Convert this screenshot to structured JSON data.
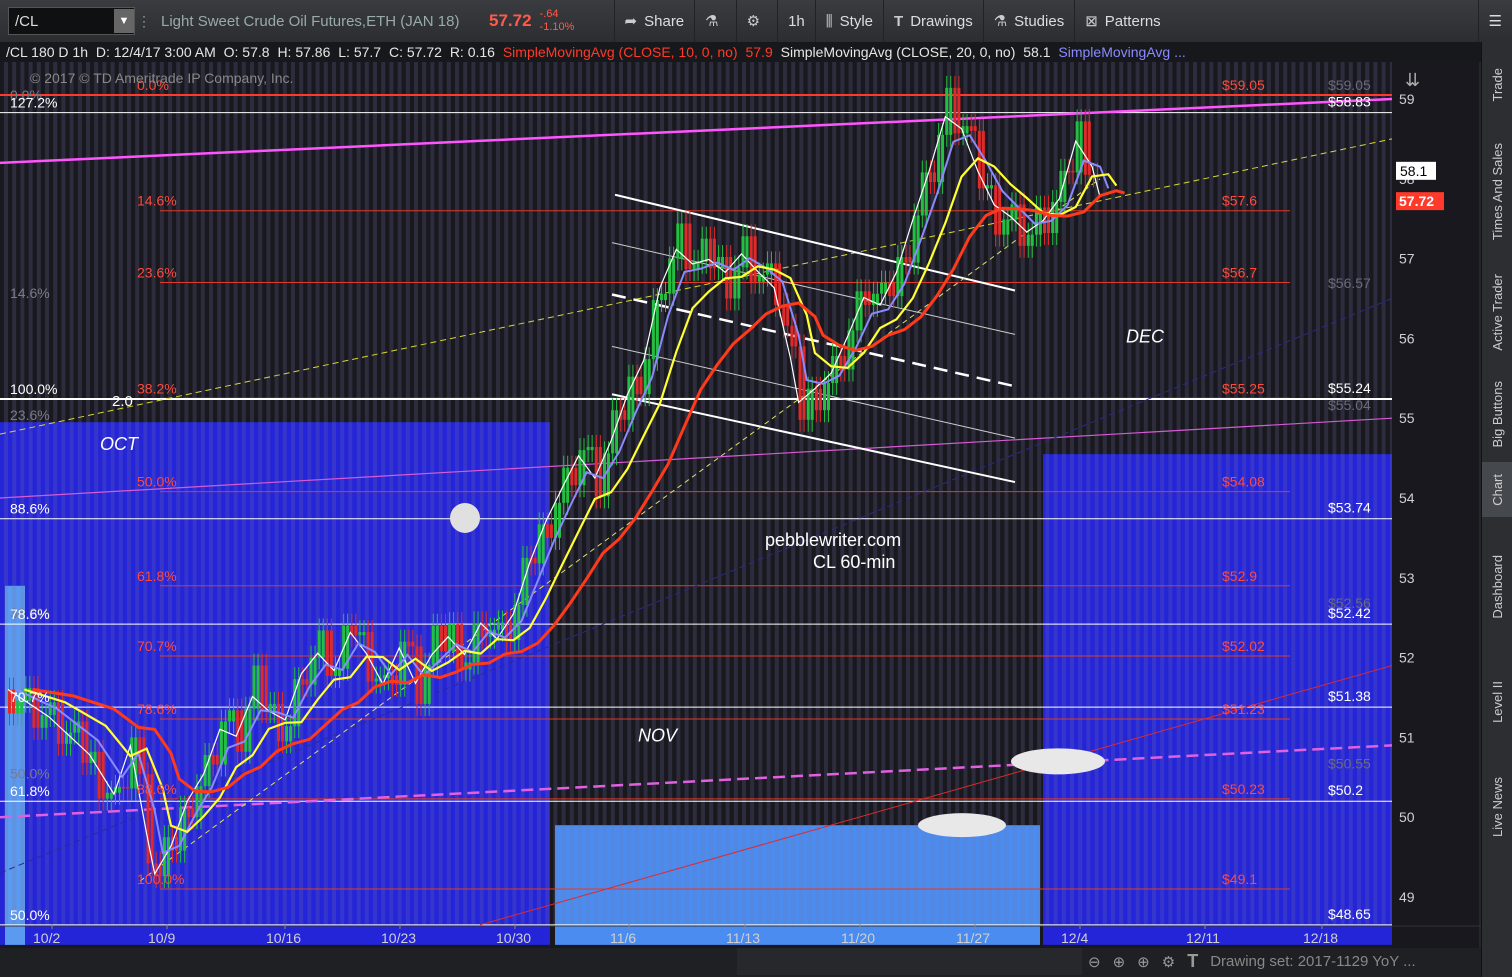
{
  "toolbar": {
    "symbol": "/CL",
    "description": "Light Sweet Crude Oil Futures,ETH (JAN 18)",
    "last_price": "57.72",
    "change": "-.64",
    "change_pct": "-1.10%",
    "share_label": "Share",
    "timeframe_label": "1h",
    "style_label": "Style",
    "drawings_label": "Drawings",
    "studies_label": "Studies",
    "patterns_label": "Patterns"
  },
  "info_bar": {
    "symbol_period": "/CL 180 D 1h",
    "date": "D: 12/4/17 3:00 AM",
    "open": "O: 57.8",
    "high": "H: 57.86",
    "low": "L: 57.7",
    "close": "C: 57.72",
    "range": "R: 0.16",
    "study1": "SimpleMovingAvg (CLOSE, 10, 0, no)",
    "study1_value": "57.9",
    "study2": "SimpleMovingAvg (CLOSE, 20, 0, no)",
    "study2_value": "58.1",
    "study3": "SimpleMovingAvg ..."
  },
  "side_tabs": [
    "Trade",
    "Times And Sales",
    "Active Trader",
    "Big Buttons",
    "Chart",
    "Dashboard",
    "Level II",
    "Live News"
  ],
  "bottom": {
    "drawing_set": "Drawing set: 2017-1129 YoY ..."
  },
  "chart_data": {
    "type": "candlestick",
    "copyright": "© 2017 © TD Ameritrade IP Company, Inc.",
    "price_axis": {
      "min": 48.65,
      "max": 59.1,
      "ticks": [
        49,
        50,
        51,
        52,
        53,
        54,
        55,
        56,
        57,
        58,
        59
      ]
    },
    "time_axis": {
      "labels": [
        "10/2",
        "10/9",
        "10/16",
        "10/23",
        "10/30",
        "11/6",
        "11/13",
        "11/20",
        "11/27",
        "12/4",
        "12/11",
        "12/18"
      ]
    },
    "price_tags": [
      {
        "label": "58.1",
        "color": "#ffffff",
        "text_color": "#000000"
      },
      {
        "label": "57.72",
        "color": "#ff3a2a",
        "text_color": "#ffffff"
      }
    ],
    "right_levels_white": [
      {
        "price": 58.83,
        "label": "$58.83"
      },
      {
        "price": 55.24,
        "label": "$55.24"
      },
      {
        "price": 53.74,
        "label": "$53.74"
      },
      {
        "price": 52.42,
        "label": "$52.42"
      },
      {
        "price": 51.38,
        "label": "$51.38"
      },
      {
        "price": 50.2,
        "label": "$50.2"
      },
      {
        "price": 48.65,
        "label": "$48.65"
      }
    ],
    "right_levels_gray": [
      {
        "price": 59.05,
        "label": "$59.05"
      },
      {
        "price": 56.57,
        "label": "$56.57"
      },
      {
        "price": 55.04,
        "label": "$55.04"
      },
      {
        "price": 52.56,
        "label": "$52.56"
      },
      {
        "price": 50.55,
        "label": "$50.55"
      }
    ],
    "fib_red": [
      {
        "price": 59.05,
        "pct": "0.0%",
        "label": "$59.05"
      },
      {
        "price": 57.6,
        "pct": "14.6%",
        "label": "$57.6"
      },
      {
        "price": 56.7,
        "pct": "23.6%",
        "label": "$56.7"
      },
      {
        "price": 55.25,
        "pct": "38.2%",
        "label": "$55.25"
      },
      {
        "price": 54.08,
        "pct": "50.0%",
        "label": "$54.08"
      },
      {
        "price": 52.9,
        "pct": "61.8%",
        "label": "$52.9"
      },
      {
        "price": 52.02,
        "pct": "70.7%",
        "label": "$52.02"
      },
      {
        "price": 51.23,
        "pct": "78.6%",
        "label": "$51.23"
      },
      {
        "price": 50.23,
        "pct": "88.6%",
        "label": "$50.23"
      },
      {
        "price": 49.1,
        "pct": "100.0%",
        "label": "$49.1"
      }
    ],
    "left_labels_white": [
      {
        "price": 58.83,
        "label": "127.2%"
      },
      {
        "price": 55.24,
        "label": "100.0%"
      },
      {
        "price": 53.74,
        "label": "88.6%"
      },
      {
        "price": 52.42,
        "label": "78.6%"
      },
      {
        "price": 51.38,
        "label": "70.7%"
      },
      {
        "price": 50.2,
        "label": "61.8%"
      },
      {
        "price": 48.65,
        "label": "50.0%"
      }
    ],
    "left_labels_gray": [
      {
        "price": 59.05,
        "label": "0.0%"
      },
      {
        "price": 56.57,
        "label": "14.6%"
      },
      {
        "price": 55.04,
        "label": "23.6%"
      },
      {
        "price": 52.56,
        "label": "38.2%"
      },
      {
        "price": 50.55,
        "label": "50.0%"
      }
    ],
    "annotations": {
      "oct": "OCT",
      "nov": "NOV",
      "dec": "DEC",
      "site": "pebblewriter.com",
      "subtitle": "CL 60-min",
      "wave": "2.0"
    },
    "ohlc_path": [
      [
        0,
        51.6
      ],
      [
        5,
        51.2
      ],
      [
        10,
        50.7
      ],
      [
        13,
        50.2
      ],
      [
        15,
        51.0
      ],
      [
        17,
        49.6
      ],
      [
        18,
        49.2
      ],
      [
        20,
        49.7
      ],
      [
        22,
        50.3
      ],
      [
        24,
        50.6
      ],
      [
        26,
        51.2
      ],
      [
        28,
        51.0
      ],
      [
        30,
        51.6
      ],
      [
        32,
        51.3
      ],
      [
        34,
        51.2
      ],
      [
        36,
        51.9
      ],
      [
        38,
        52.1
      ],
      [
        40,
        51.8
      ],
      [
        42,
        52.4
      ],
      [
        44,
        52.0
      ],
      [
        46,
        51.6
      ],
      [
        48,
        52.2
      ],
      [
        50,
        51.6
      ],
      [
        52,
        52.1
      ],
      [
        54,
        52.3
      ],
      [
        56,
        52.0
      ],
      [
        58,
        52.5
      ],
      [
        60,
        52.2
      ],
      [
        62,
        52.6
      ],
      [
        64,
        53.3
      ],
      [
        66,
        53.8
      ],
      [
        68,
        54.2
      ],
      [
        70,
        54.6
      ],
      [
        72,
        54.2
      ],
      [
        74,
        54.8
      ],
      [
        76,
        55.4
      ],
      [
        78,
        55.8
      ],
      [
        80,
        56.8
      ],
      [
        82,
        57.2
      ],
      [
        84,
        56.9
      ],
      [
        86,
        57.0
      ],
      [
        88,
        56.8
      ],
      [
        90,
        57.1
      ],
      [
        92,
        56.8
      ],
      [
        94,
        56.6
      ],
      [
        96,
        55.6
      ],
      [
        97,
        55.1
      ],
      [
        99,
        55.4
      ],
      [
        101,
        55.6
      ],
      [
        103,
        56.1
      ],
      [
        105,
        56.6
      ],
      [
        107,
        56.4
      ],
      [
        109,
        56.9
      ],
      [
        111,
        57.6
      ],
      [
        113,
        58.2
      ],
      [
        115,
        58.9
      ],
      [
        117,
        58.6
      ],
      [
        119,
        58.0
      ],
      [
        121,
        57.6
      ],
      [
        123,
        57.5
      ],
      [
        125,
        57.3
      ],
      [
        127,
        57.5
      ],
      [
        129,
        57.8
      ],
      [
        131,
        58.6
      ],
      [
        133,
        58.1
      ],
      [
        134,
        57.7
      ]
    ]
  }
}
